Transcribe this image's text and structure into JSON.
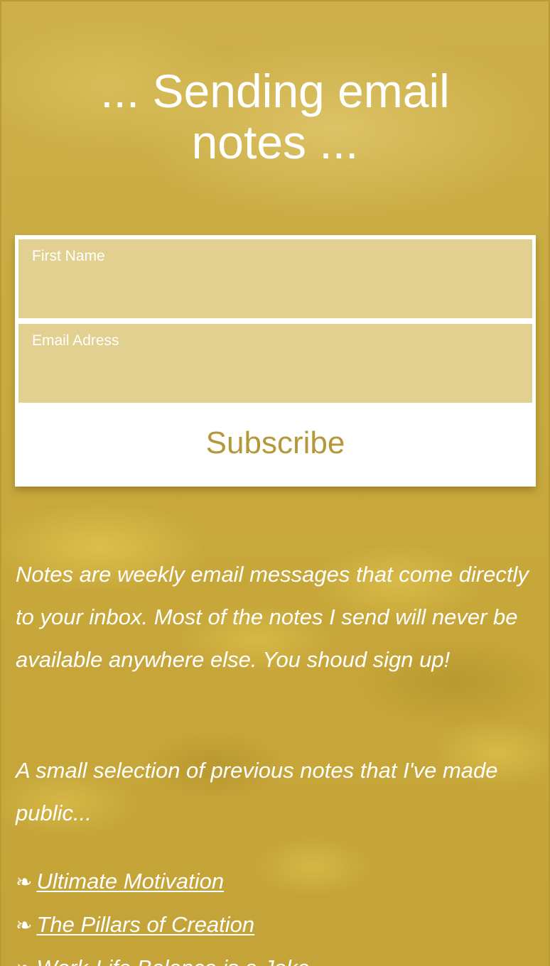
{
  "page": {
    "title": "... Sending email notes ...",
    "colors": {
      "background": "#c8a93a",
      "accent": "#b5983a",
      "text": "#ffffff"
    }
  },
  "form": {
    "first_name_label": "First Name",
    "first_name_value": "",
    "email_label": "Email Adress",
    "email_value": "",
    "subscribe_label": "Subscribe"
  },
  "content": {
    "intro": "Notes are weekly email messages that come directly to your inbox. Most of the notes I send will never be available anywhere else. You shoud sign up!",
    "selection_intro": "A small selection of previous notes that I've made public...",
    "bullet_glyph": "❧",
    "links": [
      {
        "label": "Ultimate Motivation"
      },
      {
        "label": "The Pillars of Creation"
      },
      {
        "label": "Work-Life Balance is a Joke"
      }
    ]
  }
}
